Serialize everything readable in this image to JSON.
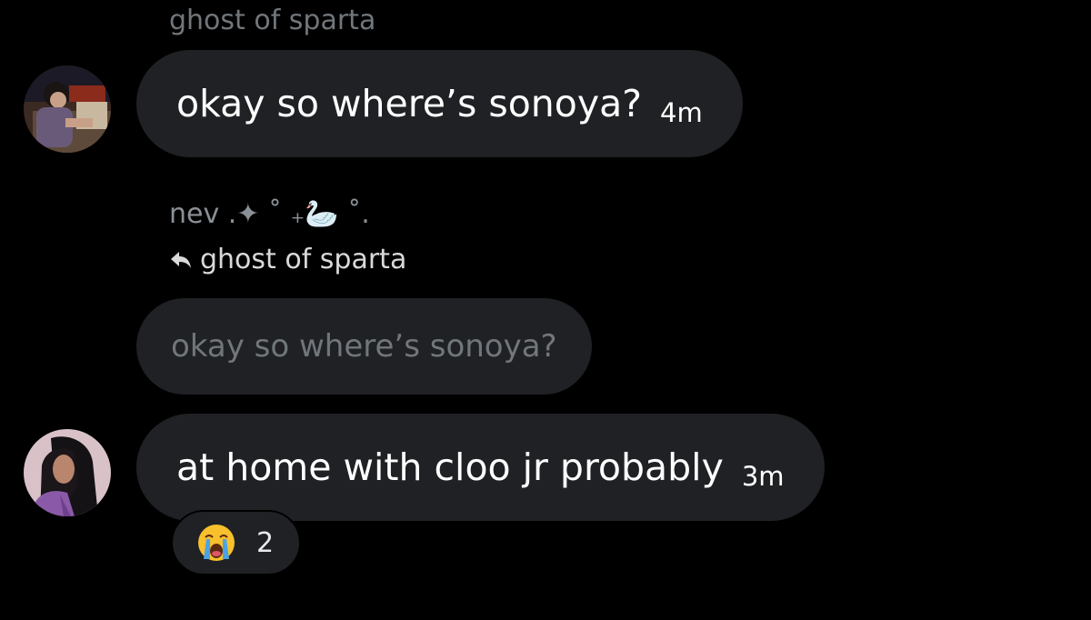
{
  "messages": [
    {
      "sender": "ghost of sparta",
      "text": "okay so where’s sonoya?",
      "time": "4m"
    },
    {
      "sender": "nev .✦ ˚ ₊🦢 ˚.",
      "reply_to": "ghost of sparta",
      "quoted_text": "okay so where’s sonoya?",
      "text": "at home with cloo jr probably",
      "time": "3m",
      "reaction": {
        "emoji": "crying-face-emoji",
        "count": "2"
      }
    }
  ],
  "colors": {
    "background": "#000000",
    "bubble": "#1f2124",
    "muted_text": "#71767b",
    "text": "#ffffff"
  }
}
